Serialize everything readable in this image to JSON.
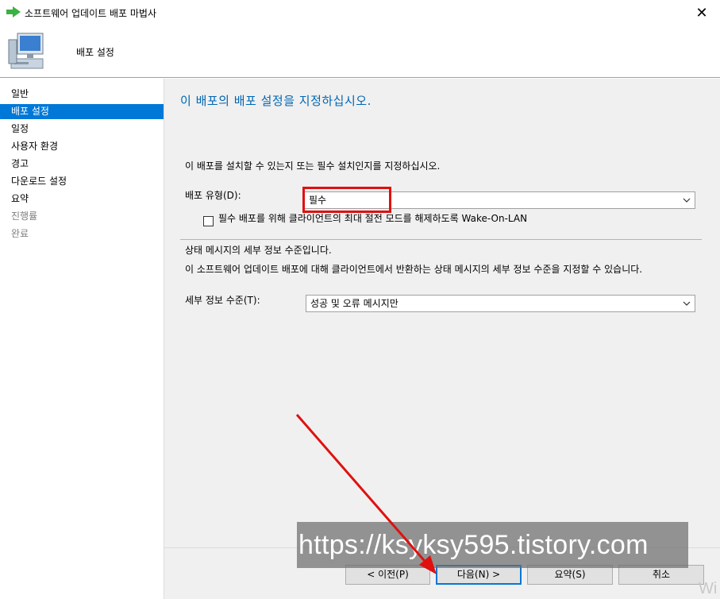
{
  "window": {
    "title": "소프트웨어 업데이트 배포 마법사",
    "close_glyph": "✕"
  },
  "header": {
    "title": "배포 설정"
  },
  "sidebar": {
    "items": [
      {
        "label": "일반",
        "state": "normal"
      },
      {
        "label": "배포 설정",
        "state": "active"
      },
      {
        "label": "일정",
        "state": "normal"
      },
      {
        "label": "사용자 환경",
        "state": "normal"
      },
      {
        "label": "경고",
        "state": "normal"
      },
      {
        "label": "다운로드 설정",
        "state": "normal"
      },
      {
        "label": "요약",
        "state": "normal"
      },
      {
        "label": "진행률",
        "state": "disabled"
      },
      {
        "label": "완료",
        "state": "disabled"
      }
    ]
  },
  "main": {
    "heading": "이 배포의 배포 설정을 지정하십시오.",
    "intro": "이 배포를 설치할 수 있는지 또는 필수 설치인지를 지정하십시오.",
    "deployment_type": {
      "label": "배포 유형(D):",
      "value": "필수"
    },
    "wol_checkbox": {
      "label": "필수 배포를 위해 클라이언트의 최대 절전 모드를 해제하도록 Wake-On-LAN",
      "checked": false
    },
    "status_section_title": "상태 메시지의 세부 정보 수준입니다.",
    "status_section_desc": "이 소프트웨어 업데이트 배포에 대해 클라이언트에서 반환하는 상태 메시지의 세부 정보 수준을 지정할 수 있습니다.",
    "detail_level": {
      "label": "세부 정보 수준(T):",
      "value": "성공 및 오류 메시지만"
    }
  },
  "buttons": {
    "prev": "< 이전(P)",
    "next": "다음(N) >",
    "summary": "요약(S)",
    "cancel": "취소"
  },
  "watermark": "https://ksyksy595.tistory.com",
  "corner_text": "Wi",
  "colors": {
    "accent": "#0078d7",
    "heading": "#0066b3",
    "annotation": "#e01010"
  }
}
